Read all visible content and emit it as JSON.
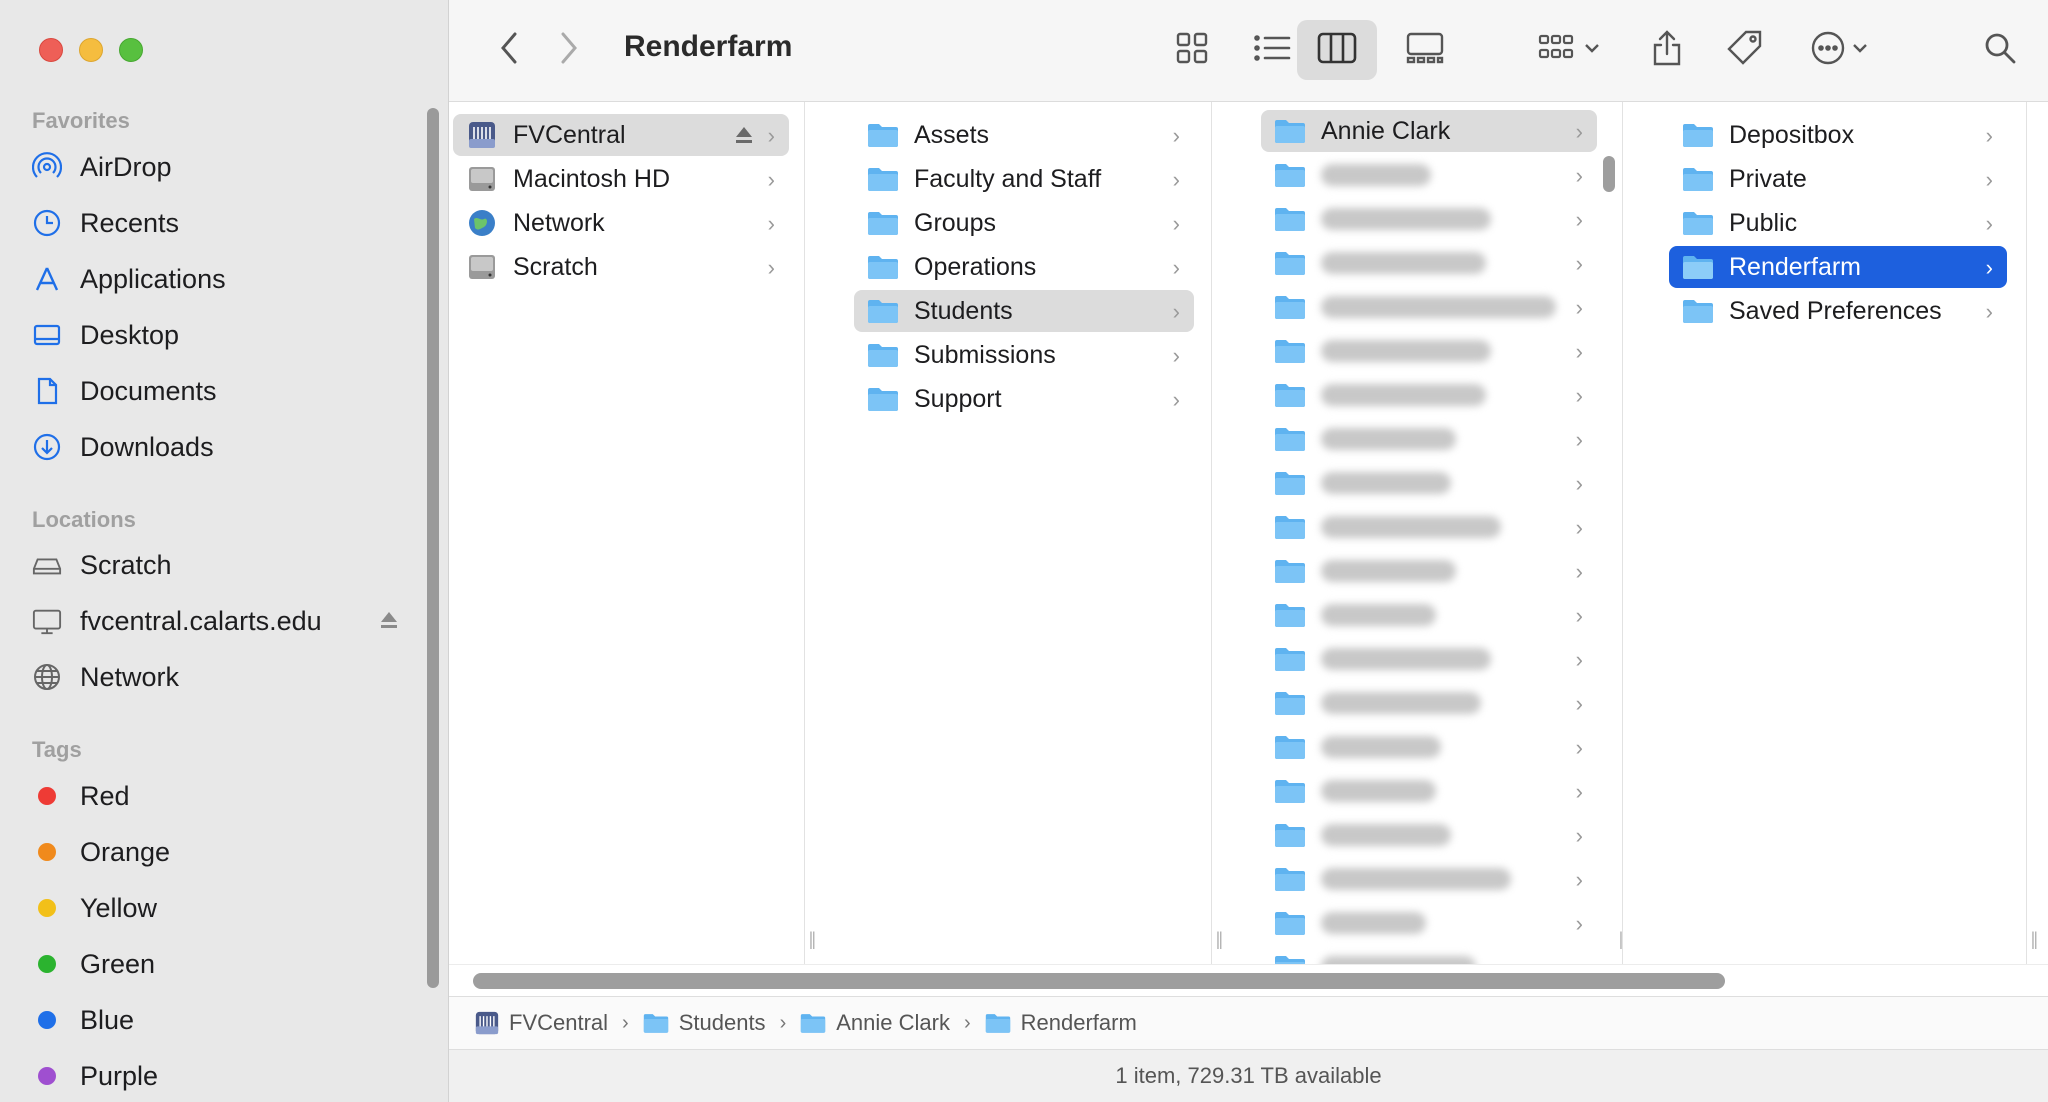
{
  "window": {
    "title": "Renderfarm"
  },
  "sidebar": {
    "favorites_title": "Favorites",
    "favorites": [
      {
        "label": "AirDrop",
        "icon": "airdrop-icon"
      },
      {
        "label": "Recents",
        "icon": "clock-icon"
      },
      {
        "label": "Applications",
        "icon": "applications-icon"
      },
      {
        "label": "Desktop",
        "icon": "desktop-icon"
      },
      {
        "label": "Documents",
        "icon": "document-icon"
      },
      {
        "label": "Downloads",
        "icon": "download-icon"
      }
    ],
    "locations_title": "Locations",
    "locations": [
      {
        "label": "Scratch",
        "icon": "drive-icon"
      },
      {
        "label": "fvcentral.calarts.edu",
        "icon": "display-icon"
      },
      {
        "label": "Network",
        "icon": "globe-icon"
      }
    ],
    "tags_title": "Tags",
    "tags": [
      {
        "label": "Red",
        "color": "#ee3b35"
      },
      {
        "label": "Orange",
        "color": "#f08a1c"
      },
      {
        "label": "Yellow",
        "color": "#f2c019"
      },
      {
        "label": "Green",
        "color": "#2bb32f"
      },
      {
        "label": "Blue",
        "color": "#1f6fe8"
      },
      {
        "label": "Purple",
        "color": "#9f4fd0"
      }
    ]
  },
  "columns": {
    "col1": [
      "FVCentral",
      "Macintosh HD",
      "Network",
      "Scratch"
    ],
    "col2": [
      "Assets",
      "Faculty and Staff",
      "Groups",
      "Operations",
      "Students",
      "Submissions",
      "Support"
    ],
    "col3_first": "Annie Clark",
    "col4": [
      "Depositbox",
      "Private",
      "Public",
      "Renderfarm",
      "Saved Preferences"
    ]
  },
  "pathbar": [
    "FVCentral",
    "Students",
    "Annie Clark",
    "Renderfarm"
  ],
  "status": {
    "text": "1 item, 729.31 TB available"
  },
  "colors": {
    "selection_blue": "#1d60de",
    "folder_blue": "#5fb3f0"
  }
}
